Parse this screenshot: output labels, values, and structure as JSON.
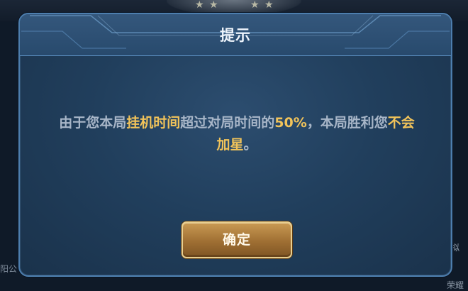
{
  "dialog": {
    "title": "提示",
    "message": {
      "part1": "由于您本局",
      "highlight1": "挂机时间",
      "part2": "超过对局时间的",
      "highlight2": "50%",
      "part3": "，本局胜利您",
      "highlight3": "不会加星",
      "part4": "。"
    },
    "confirm_label": "确定"
  },
  "background": {
    "left_text": "阳公",
    "right_text": "拟",
    "bottom_right_text": "荣耀"
  },
  "colors": {
    "highlight": "#f1c35a",
    "dialog_border": "#4d7eae",
    "button_gold": "#c99a53"
  }
}
